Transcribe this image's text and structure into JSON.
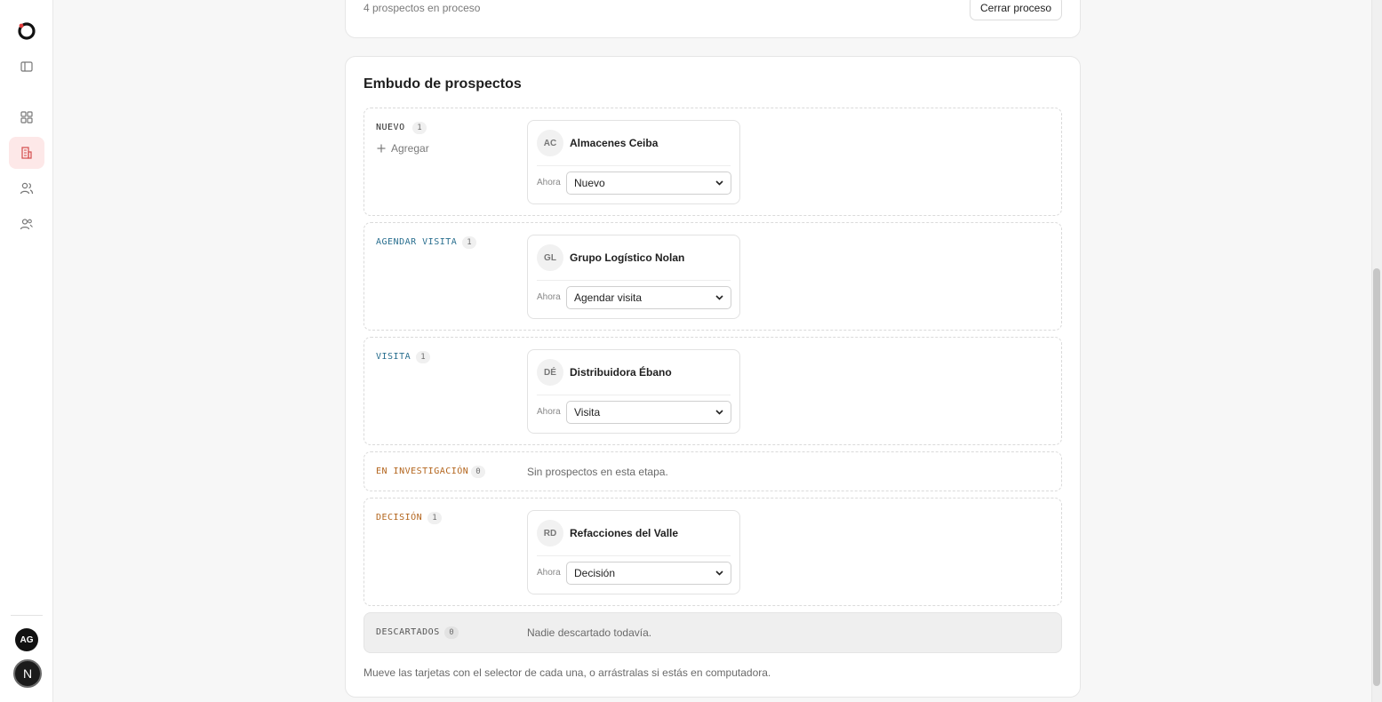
{
  "top": {
    "count_text": "4 prospectos en proceso",
    "close_label": "Cerrar proceso"
  },
  "funnel": {
    "title": "Embudo de prospectos",
    "add_label": "Agregar",
    "footer_note": "Mueve las tarjetas con el selector de cada una, o arrástralas si estás en computadora.",
    "stages": [
      {
        "label": "NUEVO",
        "count": "1",
        "color": "#2b2b2b"
      },
      {
        "label": "AGENDAR VISITA",
        "count": "1",
        "color": "#2a6f8f"
      },
      {
        "label": "VISITA",
        "count": "1",
        "color": "#2a6f8f"
      },
      {
        "label": "EN INVESTIGACIÓN",
        "count": "0",
        "color": "#b3651d",
        "empty": "Sin prospectos en esta etapa."
      },
      {
        "label": "DECISIÓN",
        "count": "1",
        "color": "#b3651d"
      },
      {
        "label": "DESCARTADOS",
        "count": "0",
        "color": "#555555",
        "empty": "Nadie descartado todavía."
      }
    ],
    "leads": [
      {
        "initials": "AC",
        "name": "Almacenes Ceiba",
        "time": "Ahora",
        "stage": "Nuevo"
      },
      {
        "initials": "GL",
        "name": "Grupo Logístico Nolan",
        "time": "Ahora",
        "stage": "Agendar visita"
      },
      {
        "initials": "DÉ",
        "name": "Distribuidora Ébano",
        "time": "Ahora",
        "stage": "Visita"
      },
      {
        "initials": "RD",
        "name": "Refacciones del Valle",
        "time": "Ahora",
        "stage": "Decisión"
      }
    ]
  },
  "sidebar": {
    "icons": [
      "logo-icon",
      "panel-toggle-icon",
      "grid-icon",
      "building-icon",
      "users-icon",
      "user-group-icon"
    ],
    "avatar_user": "AG",
    "avatar_workspace": "N"
  },
  "colors": {
    "active_bg": "#fde8e8",
    "active_icon": "#d44b4b",
    "accent_blue": "#2a6f8f",
    "accent_orange": "#b3651d"
  }
}
